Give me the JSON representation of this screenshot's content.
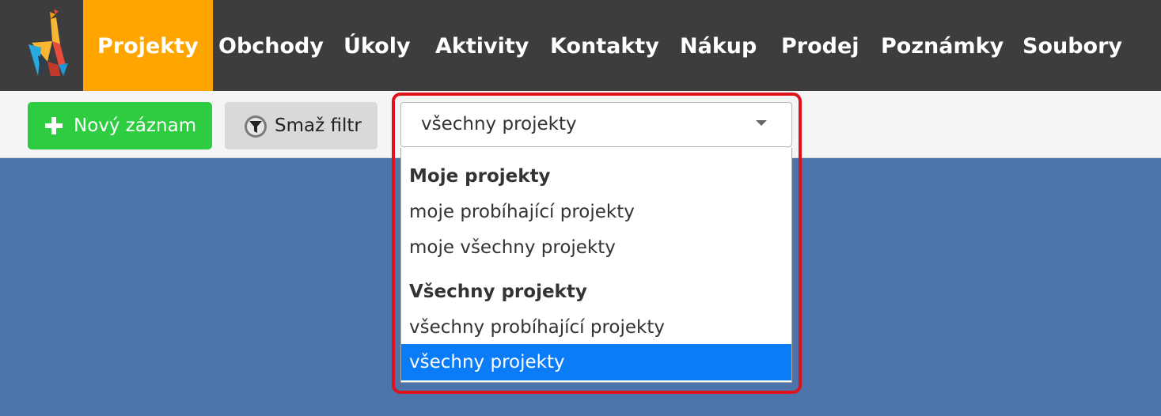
{
  "nav": {
    "items": [
      {
        "label": "Projekty",
        "active": true
      },
      {
        "label": "Obchody"
      },
      {
        "label": "Úkoly"
      },
      {
        "label": "Aktivity"
      },
      {
        "label": "Kontakty"
      },
      {
        "label": "Nákup"
      },
      {
        "label": "Prodej"
      },
      {
        "label": "Poznámky"
      },
      {
        "label": "Soubory"
      }
    ],
    "active_color": "#ffa500"
  },
  "toolbar": {
    "new_label": "Nový záznam",
    "clear_label": "Smaž filtr"
  },
  "filter": {
    "selected": "všechny projekty",
    "groups": [
      {
        "label": "Moje projekty",
        "options": [
          "moje probíhající projekty",
          "moje všechny projekty"
        ]
      },
      {
        "label": "Všechny projekty",
        "options": [
          "všechny probíhající projekty",
          "všechny projekty"
        ]
      }
    ],
    "highlight_color": "#e0101c",
    "selected_color": "#0a7cf7"
  },
  "icons": {
    "logo": "origami-giraffe-logo",
    "new": "plus-icon",
    "clear": "filter-clear-icon",
    "dropdown": "caret-down-icon"
  }
}
